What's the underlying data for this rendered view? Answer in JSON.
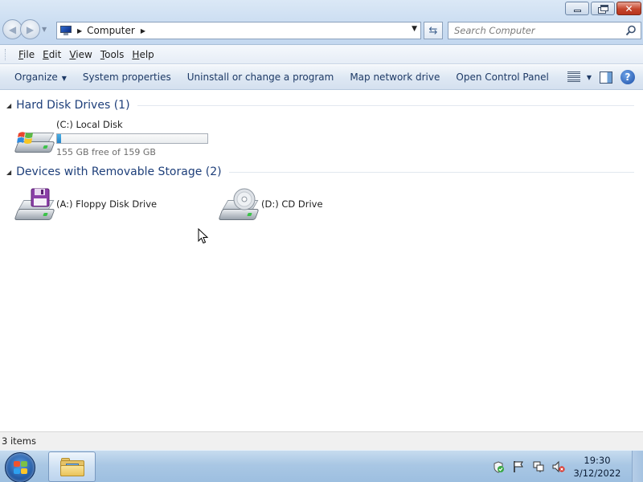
{
  "window": {
    "minimize_label": "minimize",
    "maximize_label": "maximize",
    "close_label": "close"
  },
  "address": {
    "crumbs": [
      "Computer"
    ]
  },
  "search": {
    "placeholder": "Search Computer"
  },
  "menubar": {
    "items": [
      {
        "label": "File",
        "accel": "F"
      },
      {
        "label": "Edit",
        "accel": "E"
      },
      {
        "label": "View",
        "accel": "V"
      },
      {
        "label": "Tools",
        "accel": "T"
      },
      {
        "label": "Help",
        "accel": "H"
      }
    ]
  },
  "commandbar": {
    "organize": "Organize",
    "system_properties": "System properties",
    "uninstall": "Uninstall or change a program",
    "map_drive": "Map network drive",
    "control_panel": "Open Control Panel"
  },
  "groups": {
    "hard_disks": {
      "title": "Hard Disk Drives (1)",
      "drives": [
        {
          "name": "(C:) Local Disk",
          "free_text": "155 GB free of 159 GB",
          "used_fraction": 0.025
        }
      ]
    },
    "removable": {
      "title": "Devices with Removable Storage (2)",
      "drives": [
        {
          "name": "(A:) Floppy Disk Drive"
        },
        {
          "name": "(D:) CD Drive"
        }
      ]
    }
  },
  "statusbar": {
    "text": "3 items"
  },
  "taskbar": {
    "time": "19:30",
    "date": "3/12/2022"
  },
  "colors": {
    "accent_blue": "#1e3f7a",
    "capacity_fill": "#2684c8"
  }
}
